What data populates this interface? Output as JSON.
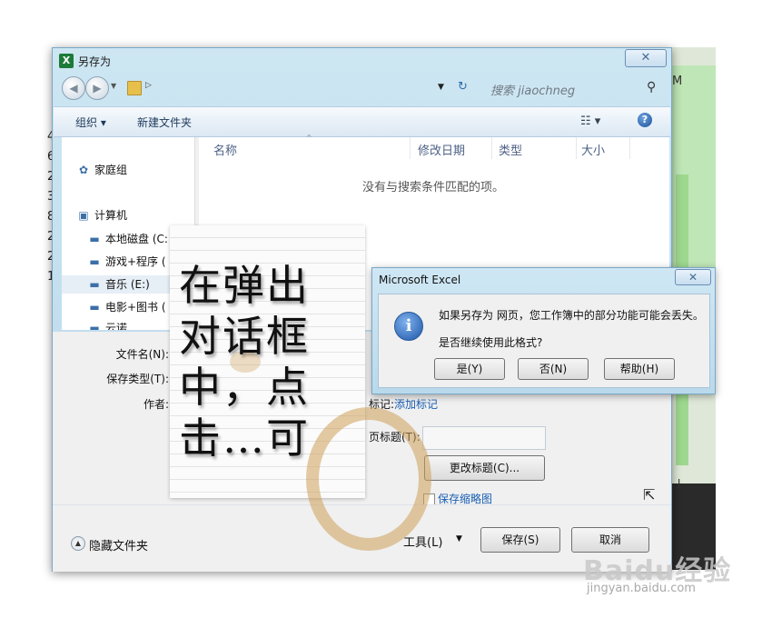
{
  "window": {
    "title": "另存为",
    "app_icon": "X",
    "close_glyph": "✕"
  },
  "nav": {
    "back_glyph": "◀",
    "forward_glyph": "▶",
    "dropdown_glyph": "▼",
    "crumb_glyph": "▷",
    "refresh_glyph": "↻",
    "search_placeholder": "搜索 jiaochneg",
    "search_glyph": "⚲"
  },
  "toolbar": {
    "organize": "组织 ▾",
    "new_folder": "新建文件夹",
    "view_glyph": "☷ ▾",
    "help_glyph": "?"
  },
  "sidebar": {
    "items": [
      {
        "label": "家庭组",
        "icon": "homegroup-icon",
        "glyph": "✿"
      },
      {
        "label": "计算机",
        "icon": "computer-icon",
        "glyph": "▣"
      },
      {
        "label": "本地磁盘 (C:",
        "icon": "drive-icon",
        "glyph": "▬"
      },
      {
        "label": "游戏+程序 (",
        "icon": "drive-icon",
        "glyph": "▬"
      },
      {
        "label": "音乐 (E:)",
        "icon": "drive-icon",
        "glyph": "▬"
      },
      {
        "label": "电影+图书 (",
        "icon": "drive-icon",
        "glyph": "▬"
      },
      {
        "label": "云诺",
        "icon": "drive-icon",
        "glyph": "▬"
      }
    ]
  },
  "file_list": {
    "columns": [
      "名称",
      "修改日期",
      "类型",
      "大小"
    ],
    "sort_glyph": "^",
    "empty_message": "没有与搜索条件匹配的项。"
  },
  "form": {
    "filename_label": "文件名(N):",
    "type_label": "保存类型(T):",
    "author_label": "作者:",
    "tag_label": "标记:",
    "tag_link": "添加标记",
    "page_title_label": "页标题(T):",
    "change_title_button": "更改标题(C)...",
    "save_thumbnail": "保存缩略图"
  },
  "bottom": {
    "hide_folders": "隐藏文件夹",
    "hide_glyph": "▲",
    "tools": "工具(L)",
    "tools_dd_glyph": "▼",
    "save": "保存(S)",
    "cancel": "取消"
  },
  "msgbox": {
    "title": "Microsoft Excel",
    "close_glyph": "✕",
    "info_glyph": "i",
    "line1": "如果另存为 网页，您工作簿中的部分功能可能会丢失。",
    "line2": "是否继续使用此格式?",
    "yes": "是(Y)",
    "no": "否(N)",
    "help": "帮助(H)"
  },
  "overlay": {
    "caption_lines": [
      "在弹出",
      "对话框",
      "中，点",
      "击…可"
    ]
  },
  "background": {
    "col_label": "M",
    "cell_label": "J",
    "row_numbers": [
      "4",
      "6",
      "2",
      "3",
      "8",
      "2",
      "2",
      "1"
    ]
  },
  "watermark": {
    "logo": "Baidu经验",
    "url": "jingyan.baidu.com"
  }
}
